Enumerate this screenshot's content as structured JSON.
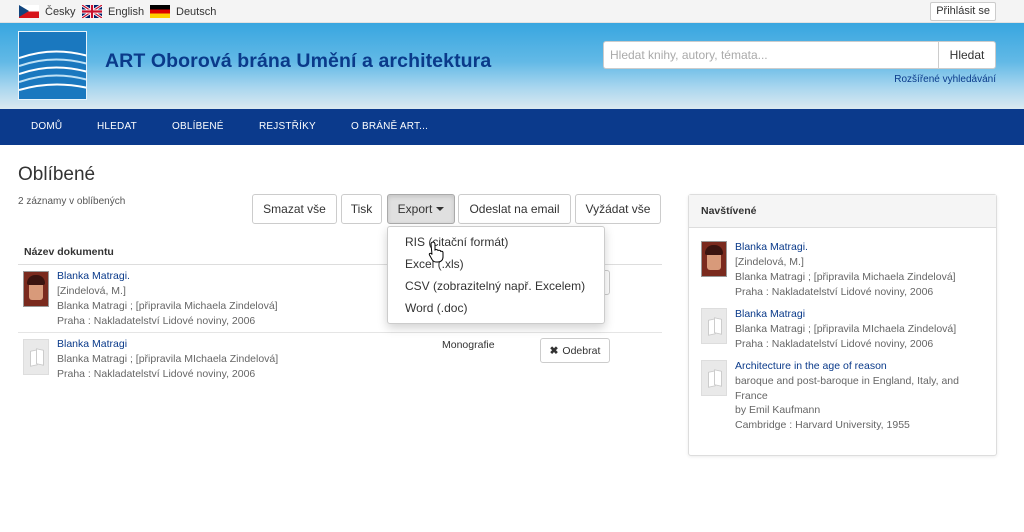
{
  "languages": [
    {
      "label": "Česky",
      "flag": "flag-cz"
    },
    {
      "label": "English",
      "flag": "flag-gb"
    },
    {
      "label": "Deutsch",
      "flag": "flag-de"
    }
  ],
  "login_label": "Přihlásit se",
  "site_title": "ART Oborová brána Umění a architektura",
  "search": {
    "placeholder": "Hledat knihy, autory, témata...",
    "button_label": "Hledat",
    "advanced_label": "Rozšířené vyhledávání"
  },
  "nav": [
    "DOMŮ",
    "HLEDAT",
    "OBLÍBENÉ",
    "REJSTŘÍKY",
    "O BRÁNĚ ART..."
  ],
  "page_title": "Oblíbené",
  "record_count": "2 záznamy v oblíbených",
  "toolbar": {
    "delete_all": "Smazat vše",
    "print": "Tisk",
    "export": "Export",
    "email": "Odeslat na email",
    "request_all": "Vyžádat vše"
  },
  "export_menu": [
    "RIS (citační formát)",
    "Excel (.xls)",
    "CSV (zobrazitelný např. Excelem)",
    "Word (.doc)"
  ],
  "table": {
    "header": "Název dokumentu",
    "rows": [
      {
        "title": "Blanka Matragi.",
        "lines": [
          "[Zindelová, M.]",
          "Blanka Matragi ; [připravila Michaela Zindelová]",
          "Praha : Nakladatelství Lidové noviny, 2006"
        ],
        "type": "",
        "thumb": "cover-image"
      },
      {
        "title": "Blanka Matragi",
        "lines": [
          "Blanka Matragi ; [připravila MIchaela Zindelová]",
          "Praha : Nakladatelství Lidové noviny, 2006"
        ],
        "type": "Monografie",
        "remove_label": "Odebrat",
        "thumb": "book-icon"
      }
    ]
  },
  "sidebar": {
    "title": "Navštívené",
    "items": [
      {
        "title": "Blanka Matragi.",
        "lines": [
          "[Zindelová, M.]",
          "Blanka Matragi ; [připravila Michaela Zindelová]",
          "Praha : Nakladatelství Lidové noviny, 2006"
        ]
      },
      {
        "title": "Blanka Matragi",
        "lines": [
          "Blanka Matragi ; [připravila MIchaela Zindelová]",
          "Praha : Nakladatelství Lidové noviny, 2006"
        ]
      },
      {
        "title": "Architecture in the age of reason",
        "lines": [
          "baroque and post-baroque in England, Italy, and",
          "France",
          "by Emil Kaufmann",
          "Cambridge : Harvard University, 1955"
        ]
      }
    ]
  },
  "colors": {
    "nav_bg": "#0b3a8c",
    "link": "#0a3a8a",
    "header_top": "#38a6e0"
  }
}
